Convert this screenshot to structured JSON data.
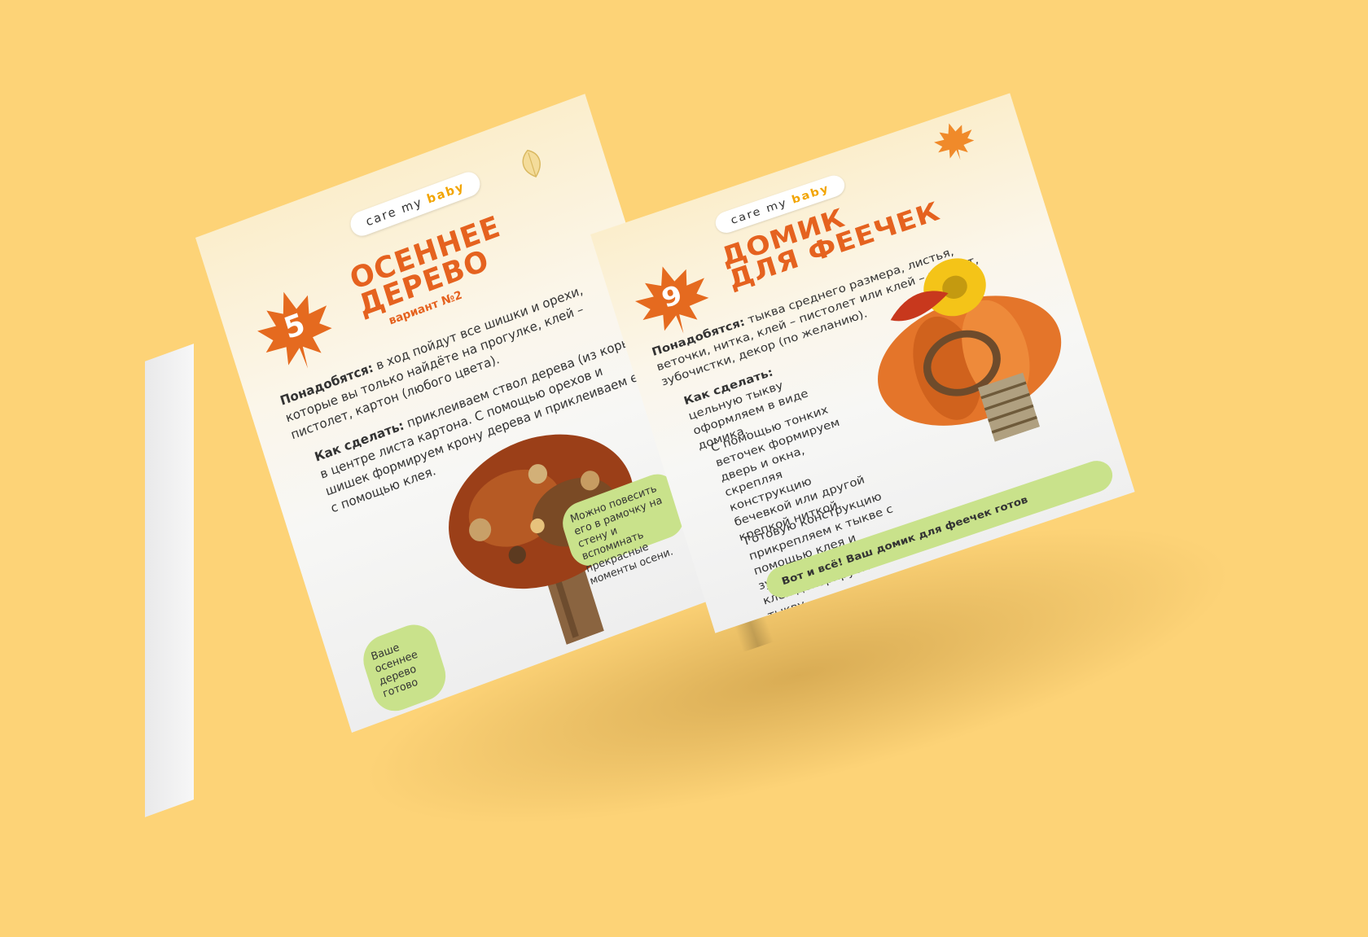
{
  "left_page": {
    "logo": {
      "part1": "care",
      "part2": "my",
      "part3": "baby"
    },
    "number": "5",
    "title_line1": "ОСЕННЕЕ",
    "title_line2": "ДЕРЕВО",
    "subtitle": "вариант №2",
    "needs_label": "Понадобятся:",
    "needs_text": "в ход пойдут все шишки и орехи, которые вы только найдёте на прогулке, клей – пистолет, картон (любого цвета).",
    "how_label": "Как сделать:",
    "how_text": "приклеиваем ствол дерева (из коры) в центре листа картона. С помощью орехов и шишек формируем крону дерева и приклеиваем её с помощью клея.",
    "tip_text": "Можно повесить его в рамочку на стену и вспоминать прекрасные моменты осени.",
    "done_text": "Ваше осеннее дерево готово"
  },
  "right_page": {
    "logo": {
      "part1": "care",
      "part2": "my",
      "part3": "baby"
    },
    "number": "9",
    "title_line1": "ДОМИК",
    "title_line2": "ДЛЯ ФЕЕЧЕК",
    "needs_label": "Понадобятся:",
    "needs_text": "тыква среднего размера, листья, веточки, нитка, клей – пистолет или клей – момент, зубочистки, декор (по желанию).",
    "how_label": "Как сделать:",
    "how_text": "цельную тыкву оформляем в виде домика.",
    "step2": "С помощью тонких веточек формируем дверь и окна, скрепляя конструкцию бечевкой или другой крепкой ниткой.",
    "step3": "Готовую конструкцию прикрепляем к тыкве с помощью клея и зубочисток. С помощью клея декорируем тыкву.",
    "done_text": "Вот и всё! Ваш домик для феечек готов"
  },
  "colors": {
    "background": "#fdd377",
    "accent": "#e5621f",
    "green": "#c9e28b"
  }
}
